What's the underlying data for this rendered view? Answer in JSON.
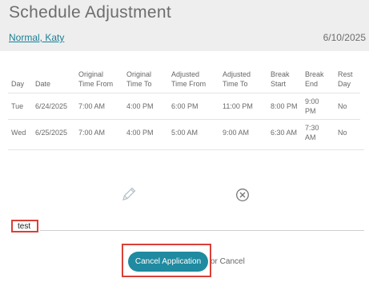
{
  "header": {
    "title": "Schedule Adjustment",
    "employee": "Normal, Katy",
    "date": "6/10/2025"
  },
  "table": {
    "columns": [
      "Day",
      "Date",
      "Original Time From",
      "Original Time To",
      "Adjusted Time From",
      "Adjusted Time To",
      "Break Start",
      "Break End",
      "Rest Day"
    ],
    "rows": [
      [
        "Tue",
        "6/24/2025",
        "7:00 AM",
        "4:00 PM",
        "6:00 PM",
        "11:00 PM",
        "8:00 PM",
        "9:00 PM",
        "No"
      ],
      [
        "Wed",
        "6/25/2025",
        "7:00 AM",
        "4:00 PM",
        "5:00 AM",
        "9:00 AM",
        "6:30 AM",
        "7:30 AM",
        "No"
      ]
    ]
  },
  "note": {
    "value": "test"
  },
  "actions": {
    "primary": "Cancel Application",
    "secondary": "or Cancel"
  },
  "icons": {
    "edit": "pencil-icon",
    "clear": "close-circle-icon"
  },
  "colors": {
    "accent": "#1f8aa0",
    "link": "#1a7f96",
    "highlight": "#d9403a"
  }
}
